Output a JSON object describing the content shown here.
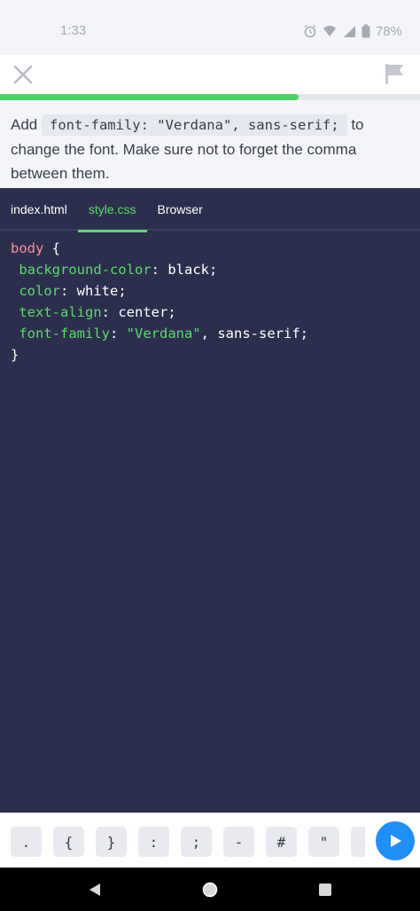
{
  "status_bar": {
    "time": "1:33",
    "battery": "78%",
    "icons": [
      "alarm-icon",
      "wifi-icon",
      "signal-icon",
      "battery-icon"
    ]
  },
  "top_bar": {
    "close_icon": "close-icon",
    "flag_icon": "flag-icon"
  },
  "progress": {
    "fraction": 0.71,
    "color": "#4fd264"
  },
  "instruction": {
    "before": "Add ",
    "code": "font-family: \"Verdana\", sans-serif;",
    "after": " to change the font. Make sure not to forget the comma between them."
  },
  "editor": {
    "tabs": [
      {
        "label": "index.html",
        "active": false
      },
      {
        "label": "style.css",
        "active": true
      },
      {
        "label": "Browser",
        "active": false
      }
    ],
    "code": {
      "line1_selector": "body",
      "line1_brace": " {",
      "line2_prop": "background-color",
      "line2_value": ": black;",
      "line3_prop": "color",
      "line3_value": ": white;",
      "line4_prop": "text-align",
      "line4_value": ": center;",
      "line5_prop": "font-family",
      "line5_sep": ": ",
      "line5_string": "\"Verdana\"",
      "line5_value": ", sans-serif;",
      "line6_brace": "}"
    },
    "background": "#2b2f4d",
    "accent": "#5fd86f"
  },
  "key_bar": {
    "keys": [
      ".",
      "{",
      "}",
      ":",
      ";",
      "-",
      "#",
      "\"",
      "("
    ],
    "run_icon": "play-icon",
    "run_color": "#1f8ef5"
  },
  "nav_bar": {
    "icons": [
      "back-icon",
      "home-icon",
      "recents-icon"
    ]
  }
}
